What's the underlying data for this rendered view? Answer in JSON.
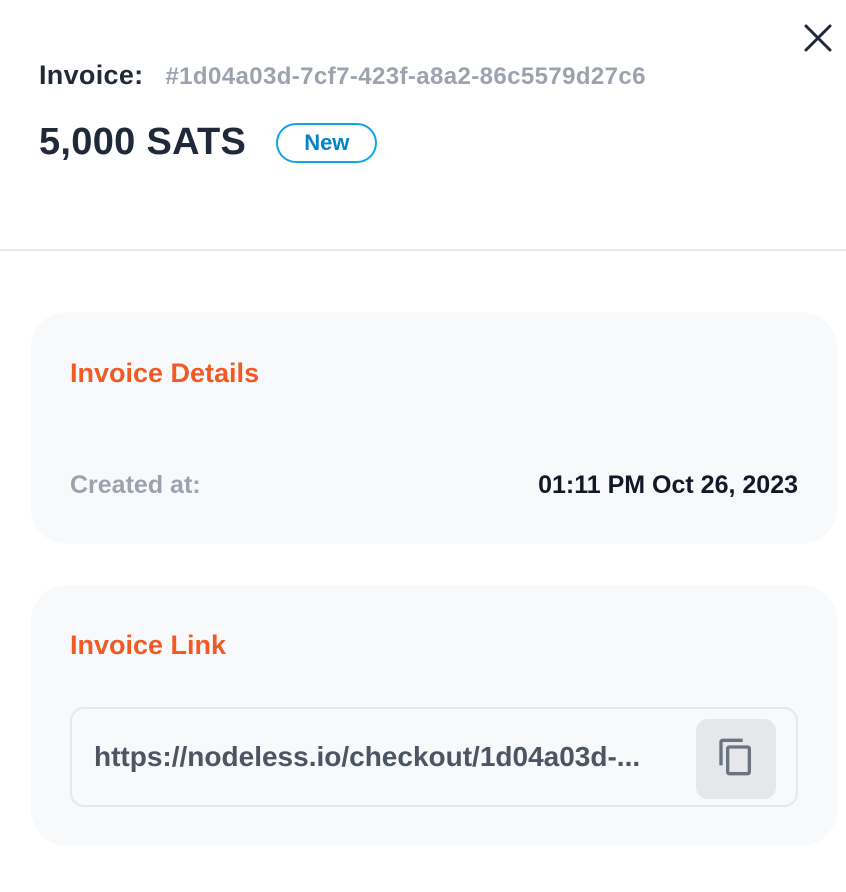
{
  "header": {
    "invoice_label": "Invoice:",
    "invoice_id": "#1d04a03d-7cf7-423f-a8a2-86c5579d27c6",
    "amount": "5,000 SATS",
    "status_badge": "New"
  },
  "details": {
    "title": "Invoice Details",
    "created_at_label": "Created at:",
    "created_at_value": "01:11 PM Oct 26, 2023"
  },
  "link": {
    "title": "Invoice Link",
    "url_display": "https://nodeless.io/checkout/1d04a03d-..."
  },
  "icons": {
    "close": "close-icon",
    "copy": "copy-icon"
  },
  "colors": {
    "accent": "#f15a24",
    "badge": "#0ea5e9",
    "text_primary": "#1f2937",
    "text_muted": "#9ca3af",
    "card_bg": "#f8f9fb"
  }
}
